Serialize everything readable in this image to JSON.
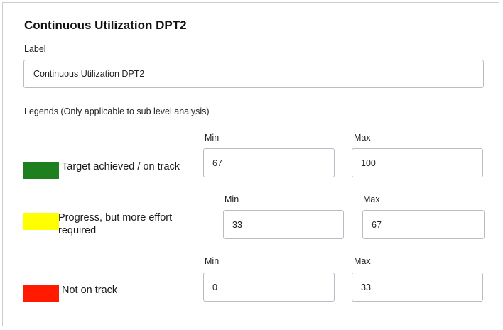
{
  "title": "Continuous Utilization DPT2",
  "label_field": {
    "caption": "Label",
    "value": "Continuous Utilization DPT2"
  },
  "legends_caption": "Legends (Only applicable to sub level analysis)",
  "legends": [
    {
      "label": "Target achieved / on track",
      "color": "#1e7f1e",
      "min_caption": "Min",
      "max_caption": "Max",
      "min": "67",
      "max": "100"
    },
    {
      "label_line1": "Progress, but more effort",
      "label_line2": "required",
      "color": "#ffff00",
      "min_caption": "Min",
      "max_caption": "Max",
      "min": "33",
      "max": "67"
    },
    {
      "label": "Not on track",
      "color": "#ff1a00",
      "min_caption": "Min",
      "max_caption": "Max",
      "min": "0",
      "max": "33"
    }
  ]
}
